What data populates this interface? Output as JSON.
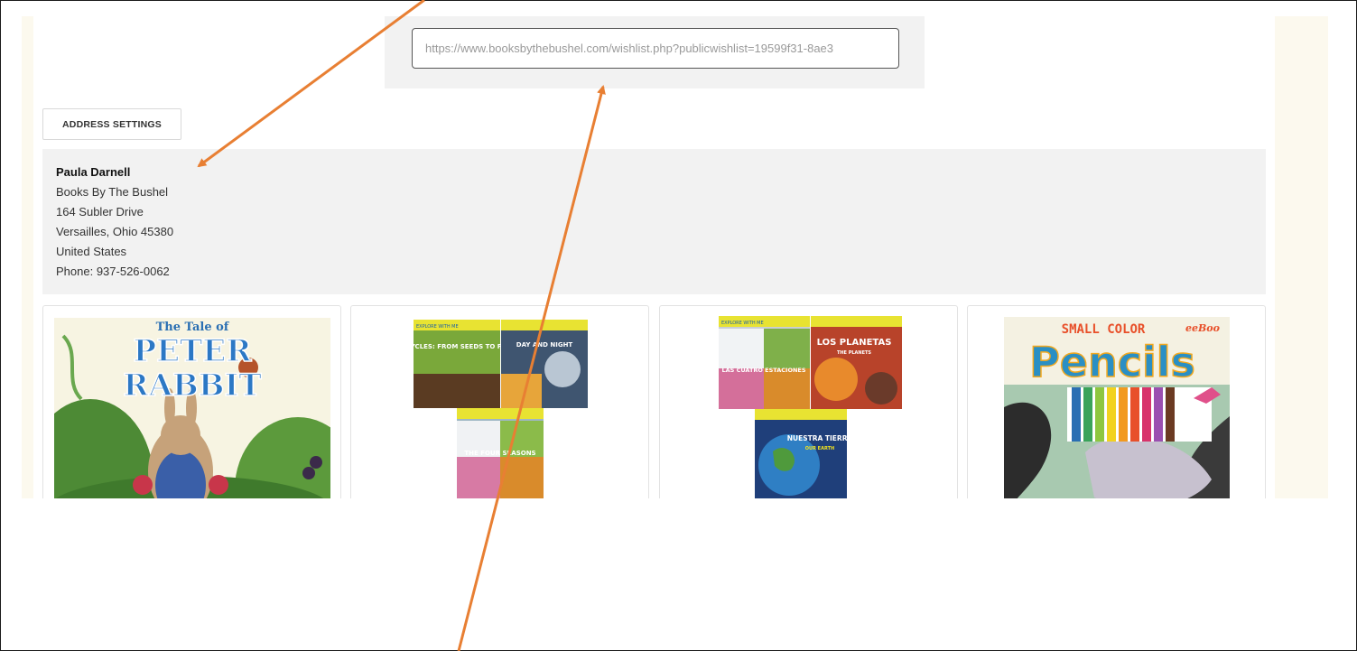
{
  "share": {
    "url": "https://www.booksbythebushel.com/wishlist.php?publicwishlist=19599f31-8ae3"
  },
  "address_settings_label": "ADDRESS SETTINGS",
  "address": {
    "name": "Paula Darnell",
    "company": "Books By The Bushel",
    "street": "164 Subler Drive",
    "city_line": "Versailles, Ohio 45380",
    "country": "United States",
    "phone": "Phone: 937-526-0062"
  },
  "products": [
    {
      "cover_top": "The Tale of",
      "cover_title_1": "PETER",
      "cover_title_2": "RABBIT"
    },
    {
      "covers": [
        "LIFE CYCLES: FROM SEEDS TO PLANTS",
        "DAY AND NIGHT",
        "THE FOUR SEASONS"
      ],
      "series": "EXPLORE WITH ME"
    },
    {
      "covers": [
        "LAS CUATRO ESTACIONES",
        "LOS PLANETAS",
        "NUESTRA TIERRA"
      ],
      "subtitles": [
        "THE PLANETS",
        "OUR EARTH"
      ],
      "series": "EXPLORE WITH ME"
    },
    {
      "cover_top": "SMALL COLOR",
      "cover_title": "Pencils",
      "brand": "eeBoo"
    }
  ],
  "colors": {
    "annotation_arrow": "#e87f33",
    "page_side_bg": "#fcf9ee",
    "panel_bg": "#f2f2f2"
  }
}
